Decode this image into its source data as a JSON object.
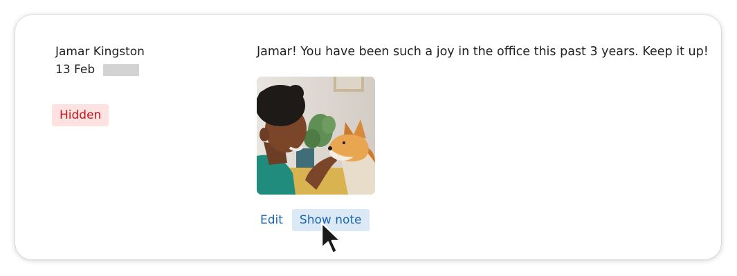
{
  "note": {
    "author": "Jamar Kingston",
    "date": "13 Feb",
    "status": "Hidden",
    "message": "Jamar! You have been such a joy in the office this past 3 years. Keep it up!",
    "attachment_icon": "photo-icon"
  },
  "actions": {
    "edit_label": "Edit",
    "show_note_label": "Show note"
  },
  "colors": {
    "status_text": "#c4161c",
    "status_bg": "#fde2e2",
    "link": "#1b66b3",
    "hover_bg": "#dbe9f7"
  }
}
